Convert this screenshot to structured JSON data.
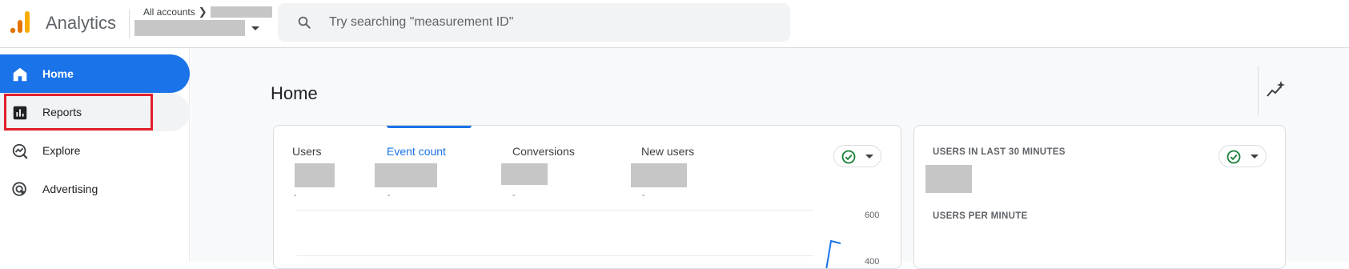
{
  "header": {
    "app_title": "Analytics",
    "breadcrumb_root": "All accounts",
    "search_placeholder": "Try searching \"measurement ID\""
  },
  "sidebar": {
    "items": [
      {
        "label": "Home",
        "icon": "home-icon",
        "active": true
      },
      {
        "label": "Reports",
        "icon": "bar-chart-icon",
        "active": false
      },
      {
        "label": "Explore",
        "icon": "explore-icon",
        "active": false
      },
      {
        "label": "Advertising",
        "icon": "advertising-icon",
        "active": false
      }
    ]
  },
  "main": {
    "page_title": "Home",
    "summary_card": {
      "tabs": [
        {
          "label": "Users",
          "dash": "-",
          "active": false
        },
        {
          "label": "Event count",
          "dash": "-",
          "active": true
        },
        {
          "label": "Conversions",
          "dash": "-",
          "active": false
        },
        {
          "label": "New users",
          "dash": "-",
          "active": false
        }
      ],
      "y_ticks": [
        "600",
        "400"
      ]
    },
    "realtime_card": {
      "users_heading": "USERS IN LAST 30 MINUTES",
      "per_minute_heading": "USERS PER MINUTE"
    }
  },
  "colors": {
    "accent": "#1a73e8",
    "highlight": "#e1202c",
    "check": "#188038"
  }
}
